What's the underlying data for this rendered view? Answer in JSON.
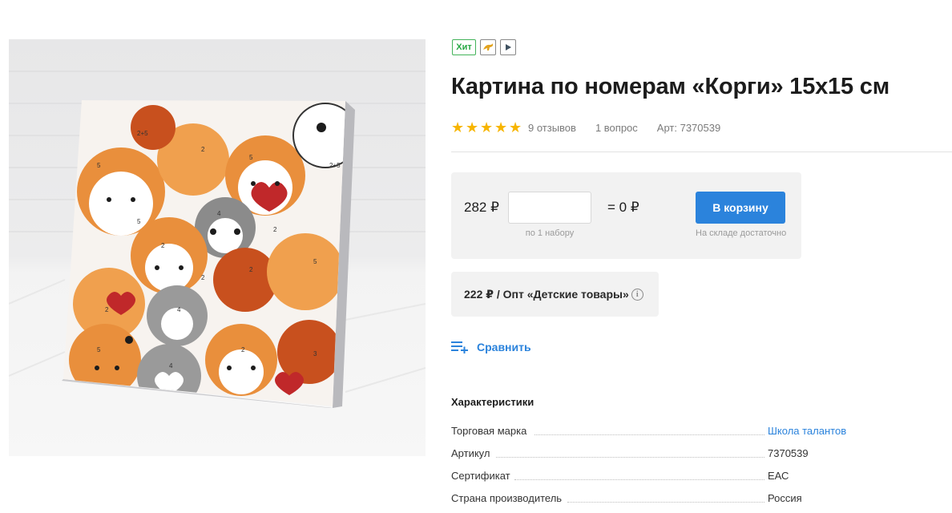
{
  "product_image": {
    "alt_icon": "corgi-painting-image"
  },
  "badges": {
    "hit_label": "Хит",
    "delivery_icon": "kangaroo-icon",
    "video_icon": "play-icon"
  },
  "product": {
    "title": "Картина по номерам «Корги» 15х15 см",
    "rating_stars": 5,
    "reviews": "9 отзывов",
    "questions": "1 вопрос",
    "sku": "Арт: 7370539"
  },
  "buy": {
    "price": "282 ₽",
    "qty_value": "",
    "qty_note": "по 1 набору",
    "total": "= 0 ₽",
    "cart_label": "В корзину",
    "stock_note": "На складе достаточно"
  },
  "opt": {
    "text": "222 ₽ / Опт «Детские товары»",
    "info_icon": "i"
  },
  "compare": {
    "label": "Сравнить"
  },
  "specs": {
    "title": "Характеристики",
    "rows": [
      {
        "key": "Торговая марка",
        "value": "Школа талантов"
      },
      {
        "key": "Артикул",
        "value": "7370539"
      },
      {
        "key": "Сертификат",
        "value": "ЕАС"
      },
      {
        "key": "Страна производитель",
        "value": "Россия"
      }
    ]
  },
  "colors": {
    "accent": "#2b83dc",
    "star": "#f7b500",
    "hit": "#27a844"
  }
}
